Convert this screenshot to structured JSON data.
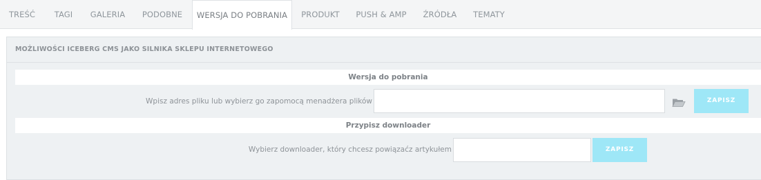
{
  "tabs": [
    {
      "label": "TREŚĆ",
      "active": false
    },
    {
      "label": "TAGI",
      "active": false
    },
    {
      "label": "GALERIA",
      "active": false
    },
    {
      "label": "PODOBNE",
      "active": false
    },
    {
      "label": "WERSJA DO POBRANIA",
      "active": true
    },
    {
      "label": "PRODUKT",
      "active": false
    },
    {
      "label": "PUSH & AMP",
      "active": false
    },
    {
      "label": "ŹRÓDŁA",
      "active": false
    },
    {
      "label": "TEMATY",
      "active": false
    }
  ],
  "panel": {
    "title": "MOŻLIWOŚCI ICEBERG CMS JAKO SILNIKA SKLEPU INTERNETOWEGO"
  },
  "download_version": {
    "heading": "Wersja do pobrania",
    "label": "Wpisz adres pliku lub wybierz go zapomocą menadżera plików",
    "value": "",
    "folder_icon": "folder-icon",
    "save_label": "ZAPISZ"
  },
  "assign_downloader": {
    "heading": "Przypisz downloader",
    "label": "Wybierz downloader, który chcesz powiązaćz artykułem",
    "value": "",
    "save_label": "ZAPISZ"
  },
  "colors": {
    "accent_button": "#9ee7f7",
    "panel_bg": "#eef1f3",
    "tabbar_bg": "#f4f5f6"
  }
}
